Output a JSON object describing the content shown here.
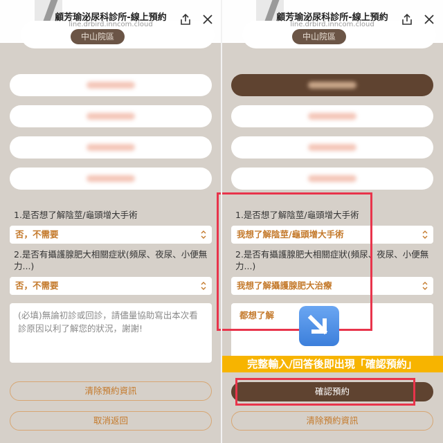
{
  "header": {
    "title": "顧芳瑜泌尿科診所-線上預約",
    "url": "line.drbird.inncom.cloud",
    "branch": "中山院區"
  },
  "left": {
    "q1": "1.是否想了解陰莖/龜頭增大手術",
    "q1_value": "否，不需要",
    "q2": "2.是否有攝護腺肥大相關症狀(頻尿、夜尿、小便無力...)",
    "q2_value": "否，不需要",
    "textarea_placeholder": "(必填)無論初診或回診，請儘量協助寫出本次看診原因以利了解您的狀況，謝謝!",
    "clear_button": "清除預約資訊",
    "cancel_button": "取消返回"
  },
  "right": {
    "q1": "1.是否想了解陰莖/龜頭增大手術",
    "q1_value": "我想了解陰莖/龜頭增大手術",
    "q2": "2.是否有攝護腺肥大相關症狀(頻尿、夜尿、小便無力...)",
    "q2_value": "我想了解攝護腺肥大治療",
    "textarea_value": "都想了解",
    "banner": "完整輸入/回答後即出現「確認預約」",
    "confirm_button": "確認預約",
    "clear_button": "清除預約資訊"
  },
  "icons": [
    "share-icon",
    "close-icon",
    "chevron-updown-icon",
    "arrow-down-right-icon"
  ],
  "colors": {
    "accent": "#c47a2c",
    "brown": "#5f4330",
    "highlight": "#e8344b",
    "banner": "#f7b400",
    "background": "#d6d0c9"
  }
}
